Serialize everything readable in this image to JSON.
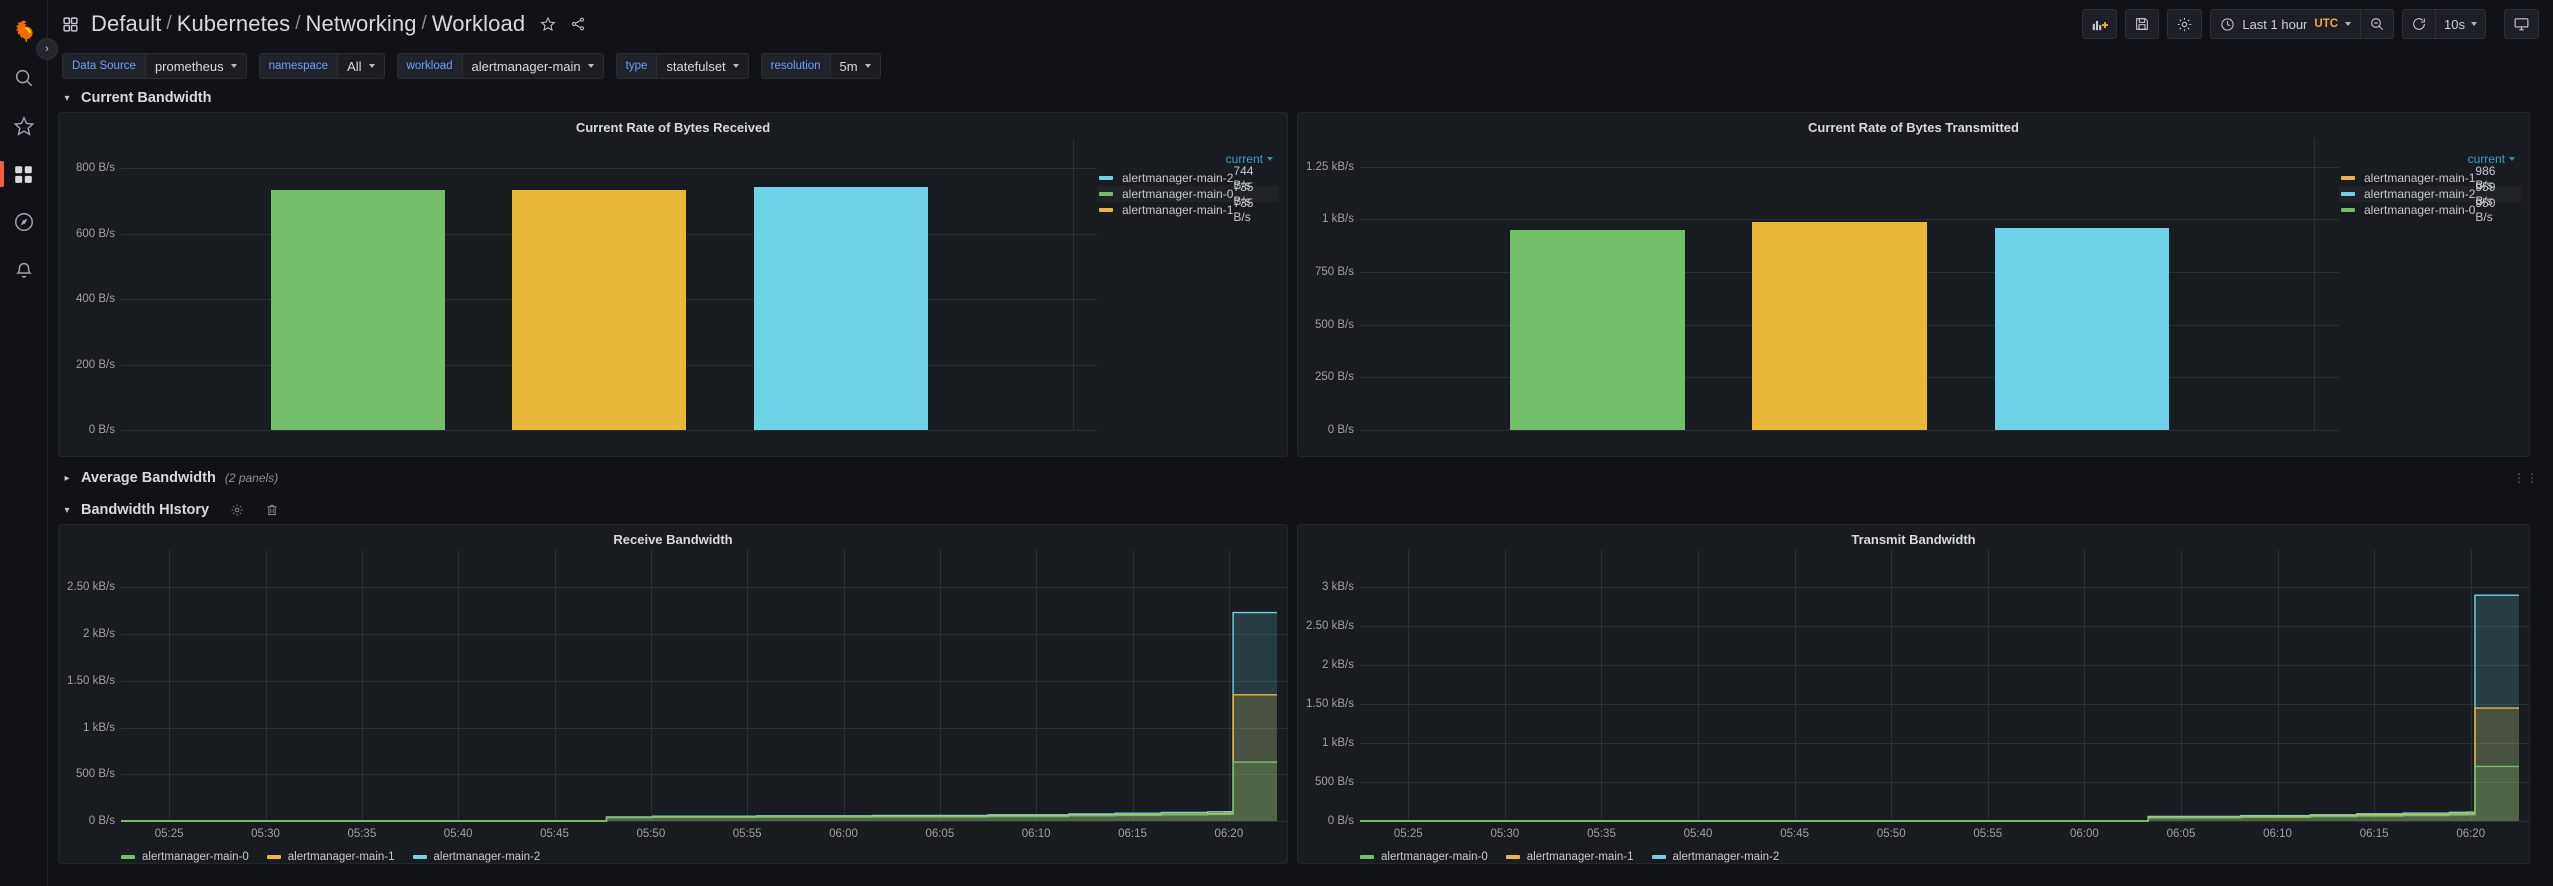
{
  "nav": {
    "items": [
      {
        "name": "grafana-logo",
        "label": "Grafana"
      },
      {
        "name": "search",
        "label": "Search"
      },
      {
        "name": "starred",
        "label": "Starred"
      },
      {
        "name": "dashboards",
        "label": "Dashboards"
      },
      {
        "name": "explore",
        "label": "Explore"
      },
      {
        "name": "alerting",
        "label": "Alerting"
      }
    ],
    "expander_label": "›"
  },
  "header": {
    "breadcrumb": [
      "Default",
      "Kubernetes",
      "Networking",
      "Workload"
    ],
    "separator": "/",
    "star_icon": "star-icon",
    "share_icon": "share-icon",
    "toolbar": {
      "add_panel_label": "",
      "save_label": "",
      "settings_label": "",
      "time_range": "Last 1 hour",
      "timezone": "UTC",
      "zoom_out_label": "",
      "refresh_interval": "10s",
      "tv_mode_label": ""
    }
  },
  "variables": [
    {
      "label": "Data Source",
      "value": "prometheus"
    },
    {
      "label": "namespace",
      "value": "All"
    },
    {
      "label": "workload",
      "value": "alertmanager-main"
    },
    {
      "label": "type",
      "value": "statefulset"
    },
    {
      "label": "resolution",
      "value": "5m"
    }
  ],
  "rows": [
    {
      "title": "Current Bandwidth",
      "collapsed": false,
      "count": ""
    },
    {
      "title": "Average Bandwidth",
      "collapsed": true,
      "count": "(2 panels)"
    },
    {
      "title": "Bandwidth HIstory",
      "collapsed": false,
      "count": ""
    }
  ],
  "colors": {
    "green": "#73bf69",
    "yellow": "#eab839",
    "cyan": "#6fd3e8",
    "accent_blue": "#6e9fff",
    "link_blue": "#3f9fd4",
    "orange": "#f2a93b",
    "panel_bg": "#181b1f",
    "page_bg": "#111217",
    "grid": "#2c2f35"
  },
  "chart_data": [
    {
      "type": "bar",
      "title": "Current Rate of Bytes Received",
      "xlabel": "",
      "ylabel": "",
      "ylim": [
        0,
        850
      ],
      "yticks": [
        "0 B/s",
        "200 B/s",
        "400 B/s",
        "600 B/s",
        "800 B/s"
      ],
      "ytick_values": [
        0,
        200,
        400,
        600,
        800
      ],
      "grid": true,
      "legend_position": "right",
      "legend_sort_column": "current",
      "categories": [
        "alertmanager-main-0",
        "alertmanager-main-1",
        "alertmanager-main-2"
      ],
      "values": [
        735,
        735,
        744
      ],
      "bar_colors": [
        "#73bf69",
        "#eab839",
        "#6fd3e8"
      ],
      "legend": [
        {
          "name": "alertmanager-main-2",
          "color": "#6fd3e8",
          "current": "744 B/s"
        },
        {
          "name": "alertmanager-main-0",
          "color": "#73bf69",
          "current": "735 B/s"
        },
        {
          "name": "alertmanager-main-1",
          "color": "#eab839",
          "current": "735 B/s"
        }
      ]
    },
    {
      "type": "bar",
      "title": "Current Rate of Bytes Transmitted",
      "xlabel": "",
      "ylabel": "",
      "ylim": [
        0,
        1320
      ],
      "yticks": [
        "0 B/s",
        "250 B/s",
        "500 B/s",
        "750 B/s",
        "1 kB/s",
        "1.25 kB/s"
      ],
      "ytick_values": [
        0,
        250,
        500,
        750,
        1000,
        1250
      ],
      "grid": true,
      "legend_position": "right",
      "legend_sort_column": "current",
      "categories": [
        "alertmanager-main-0",
        "alertmanager-main-1",
        "alertmanager-main-2"
      ],
      "values": [
        950,
        986,
        959
      ],
      "bar_colors": [
        "#73bf69",
        "#eab839",
        "#6fd3e8"
      ],
      "legend": [
        {
          "name": "alertmanager-main-1",
          "color": "#eab839",
          "current": "986 B/s"
        },
        {
          "name": "alertmanager-main-2",
          "color": "#6fd3e8",
          "current": "959 B/s"
        },
        {
          "name": "alertmanager-main-0",
          "color": "#73bf69",
          "current": "950 B/s"
        }
      ]
    },
    {
      "type": "area",
      "title": "Receive Bandwidth",
      "xlabel": "",
      "ylabel": "",
      "ylim": [
        0,
        2750
      ],
      "yticks": [
        "0 B/s",
        "500 B/s",
        "1 kB/s",
        "1.50 kB/s",
        "2 kB/s",
        "2.50 kB/s"
      ],
      "ytick_values": [
        0,
        500,
        1000,
        1500,
        2000,
        2500
      ],
      "xticks": [
        "05:25",
        "05:30",
        "05:35",
        "05:40",
        "05:45",
        "05:50",
        "05:55",
        "06:00",
        "06:05",
        "06:10",
        "06:15",
        "06:20"
      ],
      "grid": true,
      "legend_position": "bottom",
      "x": [
        0,
        0.08,
        0.18,
        0.26,
        0.35,
        0.4,
        0.42,
        0.46,
        0.55,
        0.65,
        0.75,
        0.82,
        0.86,
        0.9,
        0.94,
        0.955,
        0.962,
        1.0
      ],
      "series": [
        {
          "name": "alertmanager-main-0",
          "color": "#73bf69",
          "values": [
            0,
            0,
            0,
            0,
            0,
            0,
            35,
            40,
            42,
            44,
            48,
            55,
            60,
            66,
            70,
            72,
            630,
            630
          ]
        },
        {
          "name": "alertmanager-main-1",
          "color": "#eab839",
          "values": [
            0,
            0,
            0,
            0,
            0,
            0,
            38,
            45,
            48,
            50,
            54,
            62,
            68,
            74,
            80,
            82,
            1350,
            1350
          ]
        },
        {
          "name": "alertmanager-main-2",
          "color": "#6fd3e8",
          "values": [
            0,
            0,
            0,
            0,
            0,
            0,
            44,
            52,
            56,
            60,
            66,
            76,
            84,
            92,
            98,
            100,
            2230,
            2230
          ]
        }
      ],
      "legend": [
        {
          "name": "alertmanager-main-0",
          "color": "#73bf69"
        },
        {
          "name": "alertmanager-main-1",
          "color": "#eab839"
        },
        {
          "name": "alertmanager-main-2",
          "color": "#6fd3e8"
        }
      ]
    },
    {
      "type": "area",
      "title": "Transmit Bandwidth",
      "xlabel": "",
      "ylabel": "",
      "ylim": [
        0,
        3300
      ],
      "yticks": [
        "0 B/s",
        "500 B/s",
        "1 kB/s",
        "1.50 kB/s",
        "2 kB/s",
        "2.50 kB/s",
        "3 kB/s"
      ],
      "ytick_values": [
        0,
        500,
        1000,
        1500,
        2000,
        2500,
        3000
      ],
      "xticks": [
        "05:25",
        "05:30",
        "05:35",
        "05:40",
        "05:45",
        "05:50",
        "05:55",
        "06:00",
        "06:05",
        "06:10",
        "06:15",
        "06:20"
      ],
      "grid": true,
      "legend_position": "bottom",
      "x": [
        0,
        0.08,
        0.18,
        0.26,
        0.35,
        0.42,
        0.46,
        0.52,
        0.6,
        0.68,
        0.76,
        0.82,
        0.86,
        0.9,
        0.94,
        0.955,
        0.962,
        1.0
      ],
      "series": [
        {
          "name": "alertmanager-main-0",
          "color": "#73bf69",
          "values": [
            0,
            0,
            0,
            0,
            0,
            0,
            0,
            0,
            0,
            40,
            48,
            56,
            64,
            70,
            78,
            80,
            700,
            700
          ]
        },
        {
          "name": "alertmanager-main-1",
          "color": "#eab839",
          "values": [
            0,
            0,
            0,
            0,
            0,
            0,
            0,
            0,
            0,
            48,
            58,
            66,
            76,
            84,
            92,
            95,
            1450,
            1450
          ]
        },
        {
          "name": "alertmanager-main-2",
          "color": "#6fd3e8",
          "values": [
            0,
            0,
            0,
            0,
            0,
            0,
            0,
            0,
            0,
            58,
            70,
            80,
            92,
            102,
            112,
            115,
            2900,
            2900
          ]
        }
      ],
      "legend": [
        {
          "name": "alertmanager-main-0",
          "color": "#73bf69"
        },
        {
          "name": "alertmanager-main-1",
          "color": "#eab839"
        },
        {
          "name": "alertmanager-main-2",
          "color": "#6fd3e8"
        }
      ]
    }
  ]
}
